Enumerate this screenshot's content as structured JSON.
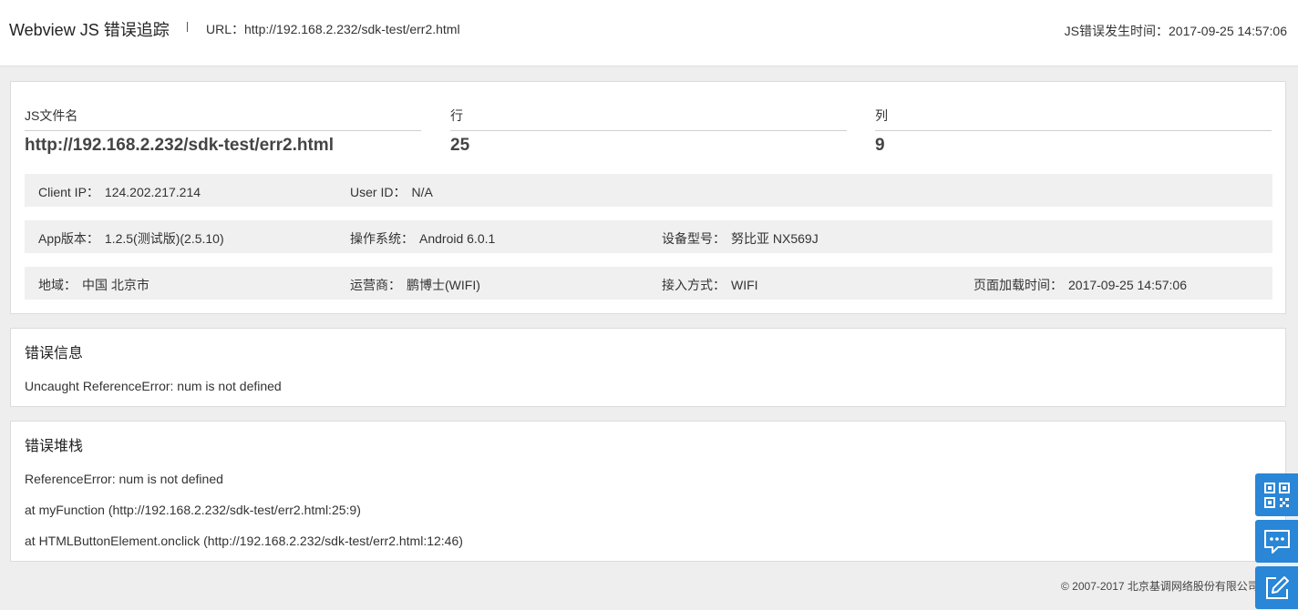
{
  "header": {
    "title": "Webview JS 错误追踪",
    "url": "URL：http://192.168.2.232/sdk-test/err2.html",
    "error_time": "JS错误发生时间：2017-09-25 14:57:06"
  },
  "summary": {
    "file_label": "JS文件名",
    "file_value": "http://192.168.2.232/sdk-test/err2.html",
    "line_label": "行",
    "line_value": "25",
    "col_label": "列",
    "col_value": "9"
  },
  "info_rows": [
    [
      {
        "key": "Client IP：",
        "value": "124.202.217.214"
      },
      {
        "key": "User ID：",
        "value": "N/A"
      }
    ],
    [
      {
        "key": "App版本：",
        "value": "1.2.5(测试版)(2.5.10)"
      },
      {
        "key": "操作系统：",
        "value": "Android 6.0.1"
      },
      {
        "key": "设备型号：",
        "value": "努比亚 NX569J"
      }
    ],
    [
      {
        "key": "地域：",
        "value": "中国 北京市"
      },
      {
        "key": "运营商：",
        "value": "鹏博士(WIFI)"
      },
      {
        "key": "接入方式：",
        "value": "WIFI"
      },
      {
        "key": "页面加载时间：",
        "value": "2017-09-25 14:57:06"
      }
    ]
  ],
  "error_info": {
    "title": "错误信息",
    "message": "Uncaught ReferenceError: num is not defined"
  },
  "error_stack": {
    "title": "错误堆栈",
    "lines": [
      "ReferenceError: num is not defined",
      "at myFunction (http://192.168.2.232/sdk-test/err2.html:25:9)",
      "at HTMLButtonElement.onclick (http://192.168.2.232/sdk-test/err2.html:12:46)"
    ]
  },
  "footer": {
    "copyright": "© 2007-2017  北京基调网络股份有限公司"
  },
  "float_buttons": [
    {
      "icon": "qrcode-icon"
    },
    {
      "icon": "chat-icon"
    },
    {
      "icon": "edit-icon"
    }
  ],
  "colors": {
    "accent": "#2a86d6",
    "page_bg": "#eeeeee",
    "row_bg": "#f0f0f0"
  }
}
